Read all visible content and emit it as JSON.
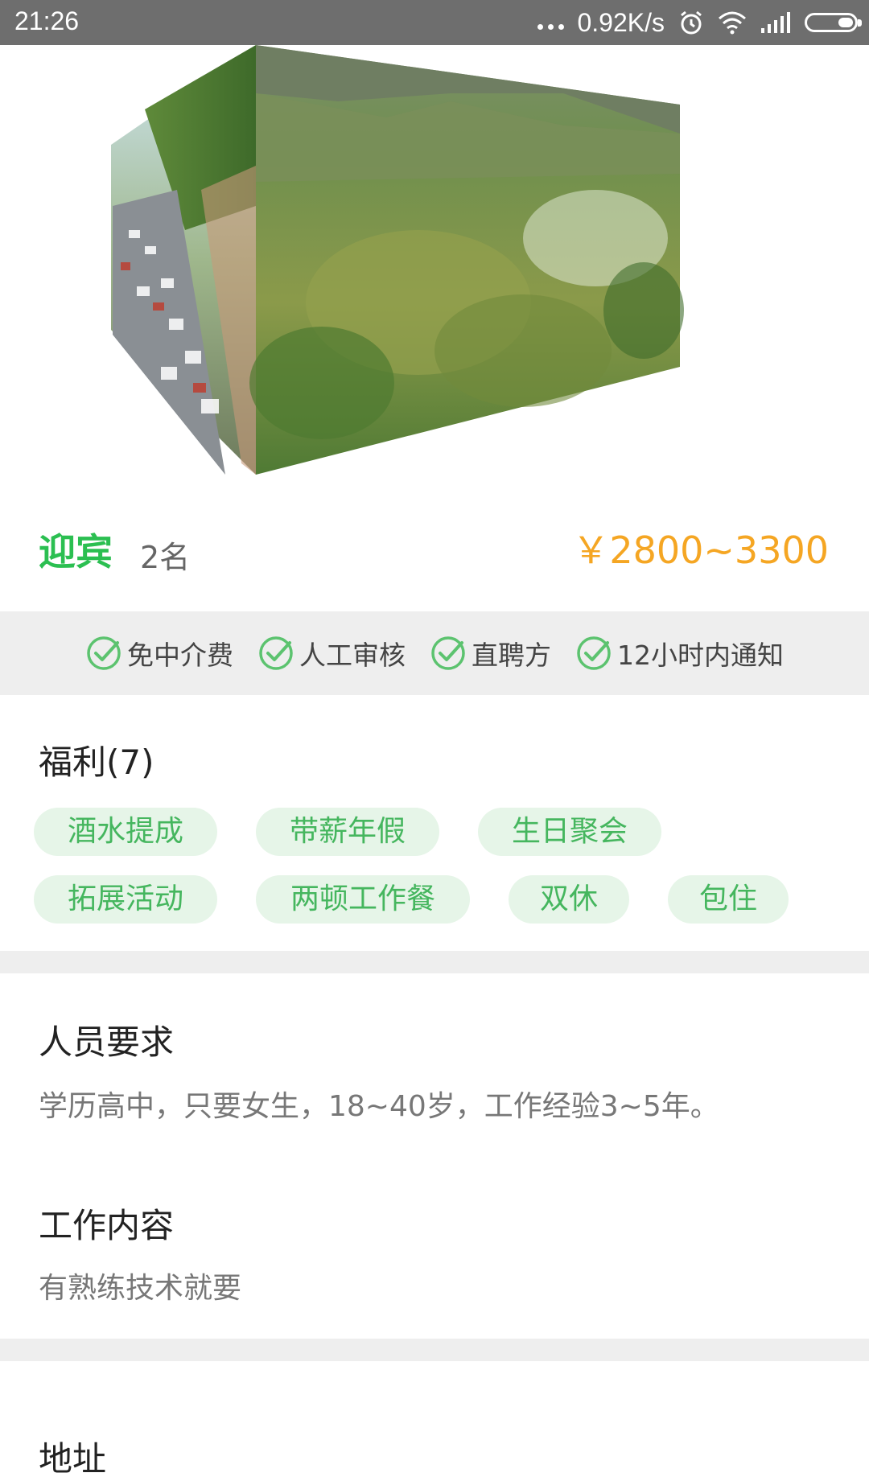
{
  "status_bar": {
    "time": "21:26",
    "network_speed": "0.92K/s",
    "icons": [
      "more-dots-icon",
      "alarm-icon",
      "wifi-icon",
      "signal-icon",
      "battery-icon"
    ]
  },
  "job": {
    "title": "迎宾",
    "count": "2名",
    "salary": "￥2800~3300"
  },
  "guarantees": [
    {
      "label": "免中介费",
      "icon": "check-circle-icon"
    },
    {
      "label": "人工审核",
      "icon": "check-circle-icon"
    },
    {
      "label": "直聘方",
      "icon": "check-circle-icon"
    },
    {
      "label": "12小时内通知",
      "icon": "check-circle-icon"
    }
  ],
  "benefits": {
    "heading": "福利(7)",
    "tags": [
      "酒水提成",
      "带薪年假",
      "生日聚会",
      "拓展活动",
      "两顿工作餐",
      "双休",
      "包住"
    ]
  },
  "requirements": {
    "heading": "人员要求",
    "text": "学历高中，只要女生，18~40岁，工作经验3~5年。"
  },
  "work_content": {
    "heading": "工作内容",
    "text": "有熟练技术就要"
  },
  "address": {
    "heading": "地址"
  },
  "colors": {
    "accent_green": "#2bbf51",
    "tag_bg": "#e6f5e8",
    "tag_text": "#45b65e",
    "salary_orange": "#f5a623",
    "divider_gray": "#eeeeee",
    "status_bar": "#6e6e6e"
  }
}
